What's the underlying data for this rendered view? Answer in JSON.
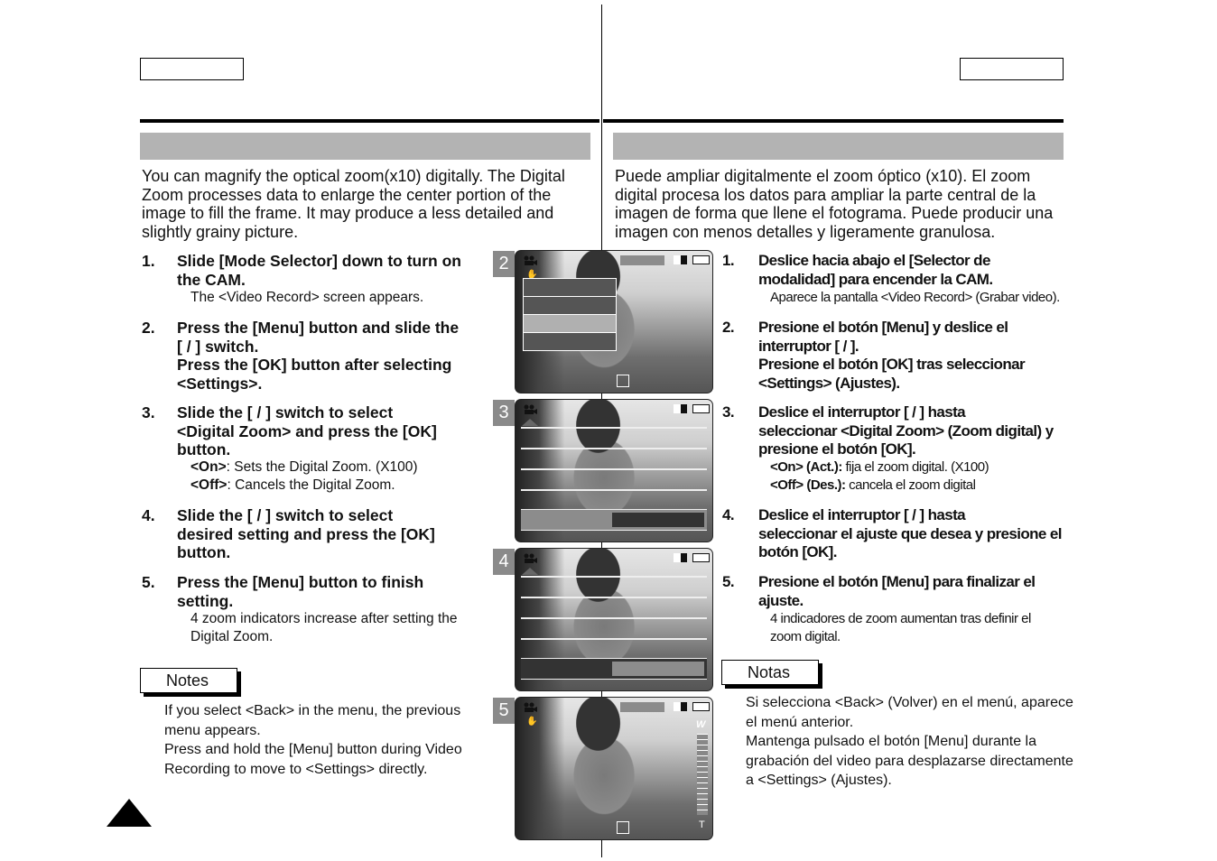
{
  "left": {
    "intro": "You can magnify the optical zoom(x10) digitally. The Digital\nZoom processes data to enlarge the center portion of the\nimage to fill the frame. It may produce a less detailed and\nslightly grainy picture.",
    "steps": [
      {
        "num": "1.",
        "text": "Slide [Mode Selector] down to turn on\nthe CAM.",
        "sub": "The <Video Record> screen appears."
      },
      {
        "num": "2.",
        "text": "Press the [Menu] button and slide the\n[     /     ] switch.\nPress the [OK] button after selecting\n<Settings>."
      },
      {
        "num": "3.",
        "text": "Slide the [     /     ] switch to select\n<Digital Zoom> and press the [OK]\nbutton.",
        "sub_on_label": "<On>",
        "sub_on": ": Sets the Digital Zoom. (X100)",
        "sub_off_label": "<Off>",
        "sub_off": ": Cancels the Digital Zoom."
      },
      {
        "num": "4.",
        "text": "Slide the [     /     ] switch to select\ndesired setting and press the [OK]\nbutton."
      },
      {
        "num": "5.",
        "text": "Press the [Menu] button to finish\nsetting.",
        "sub": "4 zoom indicators increase after setting the\nDigital Zoom."
      }
    ],
    "notes_label": "Notes",
    "notes": "If you select <Back> in the menu, the previous\nmenu appears.\nPress and hold the [Menu] button during Video\nRecording to move to <Settings> directly."
  },
  "right": {
    "intro": "Puede ampliar digitalmente el zoom óptico (x10). El zoom\ndigital procesa los datos para ampliar la parte central de la\nimagen de forma que llene el fotograma. Puede producir una\nimagen con menos detalles y ligeramente granulosa.",
    "steps": [
      {
        "num": "1.",
        "text": "Deslice hacia abajo el [Selector de\nmodalidad] para encender la CAM.",
        "sub": "Aparece la pantalla <Video Record> (Grabar video)."
      },
      {
        "num": "2.",
        "text": "Presione el botón [Menu] y deslice el\ninterruptor [     /     ].\nPresione el botón [OK] tras seleccionar\n<Settings> (Ajustes)."
      },
      {
        "num": "3.",
        "text": "Deslice el interruptor [     /     ] hasta\nseleccionar <Digital Zoom> (Zoom digital) y\npresione el botón [OK].",
        "sub_on_label": "<On> (Act.):",
        "sub_on": " fija el zoom digital. (X100)",
        "sub_off_label": "<Off> (Des.):",
        "sub_off": " cancela el zoom digital"
      },
      {
        "num": "4.",
        "text": "Deslice el interruptor [     /     ] hasta\nseleccionar el ajuste que desea y presione el\nbotón [OK]."
      },
      {
        "num": "5.",
        "text": "Presione el botón [Menu] para finalizar el\najuste.",
        "sub": "4 indicadores de zoom aumentan tras definir el\nzoom digital."
      }
    ],
    "notes_label": "Notas",
    "notes": "Si selecciona <Back> (Volver) en el menú, aparece\nel menú anterior.\nMantenga pulsado el botón [Menu] durante la\ngrabación del video para desplazarse directamente\na <Settings> (Ajustes)."
  },
  "screens": [
    {
      "step": "2",
      "icons": [
        "video-camera-icon",
        "anti-shake-icon",
        "quality-icon",
        "battery-icon"
      ]
    },
    {
      "step": "3",
      "icons": [
        "video-camera-icon",
        "quality-icon",
        "battery-icon",
        "scroll-up-icon",
        "scroll-down-icon"
      ]
    },
    {
      "step": "4",
      "icons": [
        "video-camera-icon",
        "quality-icon",
        "battery-icon",
        "scroll-up-icon",
        "scroll-down-icon"
      ]
    },
    {
      "step": "5",
      "zoom_wide": "W",
      "zoom_tele": "T",
      "icons": [
        "video-camera-icon",
        "anti-shake-icon",
        "quality-icon",
        "battery-icon",
        "zoom-bar-icon"
      ]
    }
  ]
}
